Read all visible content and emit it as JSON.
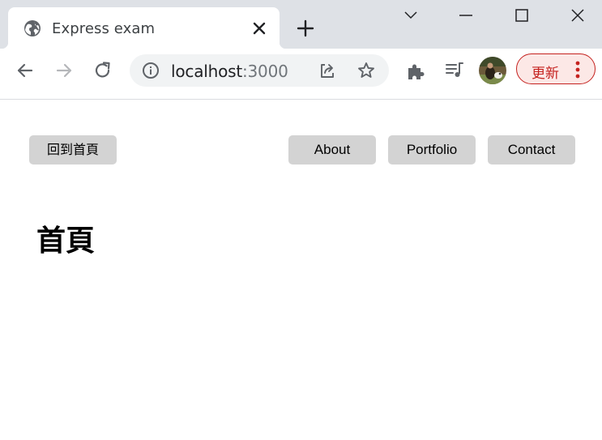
{
  "browser": {
    "tab": {
      "title": "Express exam",
      "favicon": "globe-icon"
    },
    "address_bar": {
      "host": "localhost",
      "port": ":3000"
    },
    "update_button": {
      "label": "更新",
      "color": "#c5221f"
    }
  },
  "page": {
    "home_link": "回到首頁",
    "nav": [
      {
        "label": "About"
      },
      {
        "label": "Portfolio"
      },
      {
        "label": "Contact"
      }
    ],
    "heading": "首頁"
  },
  "colors": {
    "tabstrip_bg": "#dee1e6",
    "nav_button_bg": "#d3d3d3",
    "omnibox_bg": "#f1f3f4"
  }
}
